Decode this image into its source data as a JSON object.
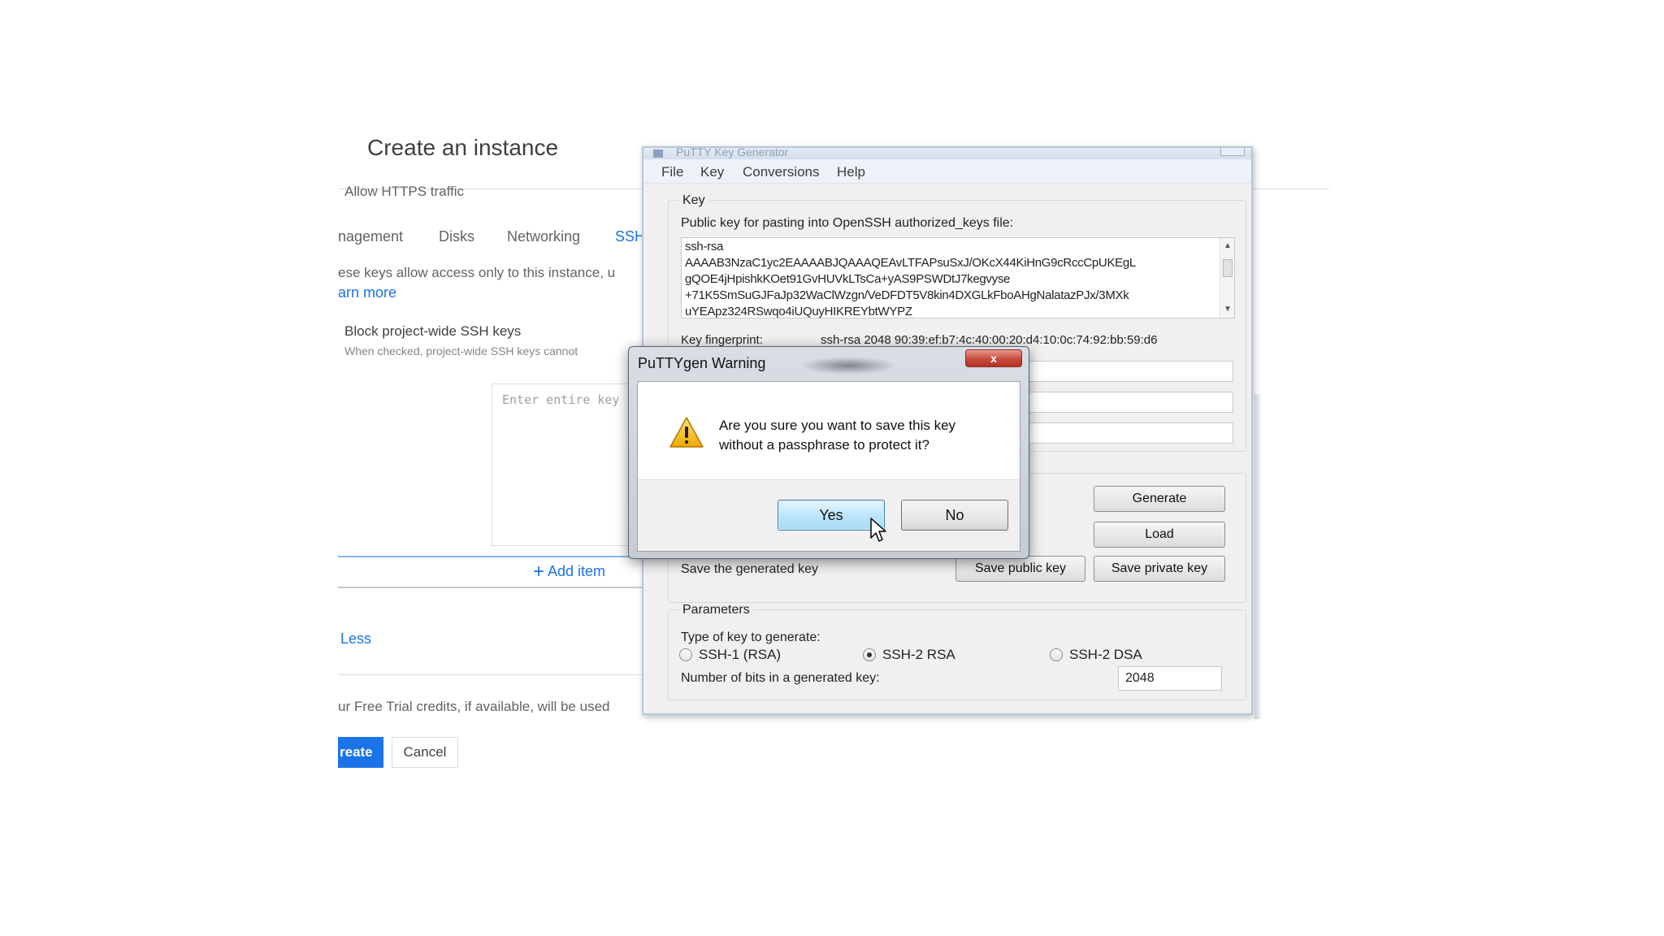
{
  "gcp": {
    "title": "Create an instance",
    "https_row": "Allow HTTPS traffic",
    "tabs": [
      {
        "label": "nagement"
      },
      {
        "label": "Disks"
      },
      {
        "label": "Networking"
      },
      {
        "label": "SSH"
      }
    ],
    "ssh_desc": "ese keys allow access only to this instance, u",
    "learn_more": "arn more",
    "block_label": "Block project-wide SSH keys",
    "block_sub": "When checked, project-wide SSH keys cannot",
    "key_placeholder": "Enter entire key",
    "add_item": "Add item",
    "less": "Less",
    "free_trial": "ur Free Trial credits, if available, will be used",
    "create_button": "reate",
    "cancel_button": "Cancel",
    "colors": {
      "accent": "#1a73e8"
    }
  },
  "putty": {
    "window_title": "PuTTY Key Generator",
    "menu": [
      {
        "label": "File"
      },
      {
        "label": "Key"
      },
      {
        "label": "Conversions"
      },
      {
        "label": "Help"
      }
    ],
    "key_group": "Key",
    "pubkey_label": "Public key for pasting into OpenSSH authorized_keys file:",
    "pubkey_lines": [
      "ssh-rsa",
      "AAAAB3NzaC1yc2EAAAABJQAAAQEAvLTFAPsuSxJ/OKcX44KiHnG9cRccCpUKEgL",
      "gQOE4jHpishkKOet91GvHUVkLTsCa+yAS9PSWDtJ7kegvyse",
      "+71K5SmSuGJFaJp32WaClWzgn/VeDFDT5V8kin4DXGLkFboAHgNalatazPJx/3MXk",
      "uYEApz324RSwqo4iUQuyHIKREYbtWYPZ"
    ],
    "fingerprint_label": "Key fingerprint:",
    "fingerprint_value": "ssh-rsa 2048 90:39:ef:b7:4c:40:00:20:d4:10:0c:74:92:bb:59:d6",
    "actions": {
      "generate": "Generate",
      "load": "Load",
      "save_label": "Save the generated key",
      "save_public": "Save public key",
      "save_private": "Save private key"
    },
    "parameters": {
      "group": "Parameters",
      "type_label": "Type of key to generate:",
      "options": [
        {
          "label": "SSH-1 (RSA)",
          "checked": false
        },
        {
          "label": "SSH-2 RSA",
          "checked": true
        },
        {
          "label": "SSH-2 DSA",
          "checked": false
        }
      ],
      "bits_label": "Number of bits in a generated key:",
      "bits_value": "2048"
    }
  },
  "warning": {
    "title": "PuTTYgen Warning",
    "close": "x",
    "icon": "warning-triangle-icon",
    "message_line1": "Are you sure you want to save this key",
    "message_line2": "without a passphrase to protect it?",
    "yes": "Yes",
    "no": "No"
  }
}
